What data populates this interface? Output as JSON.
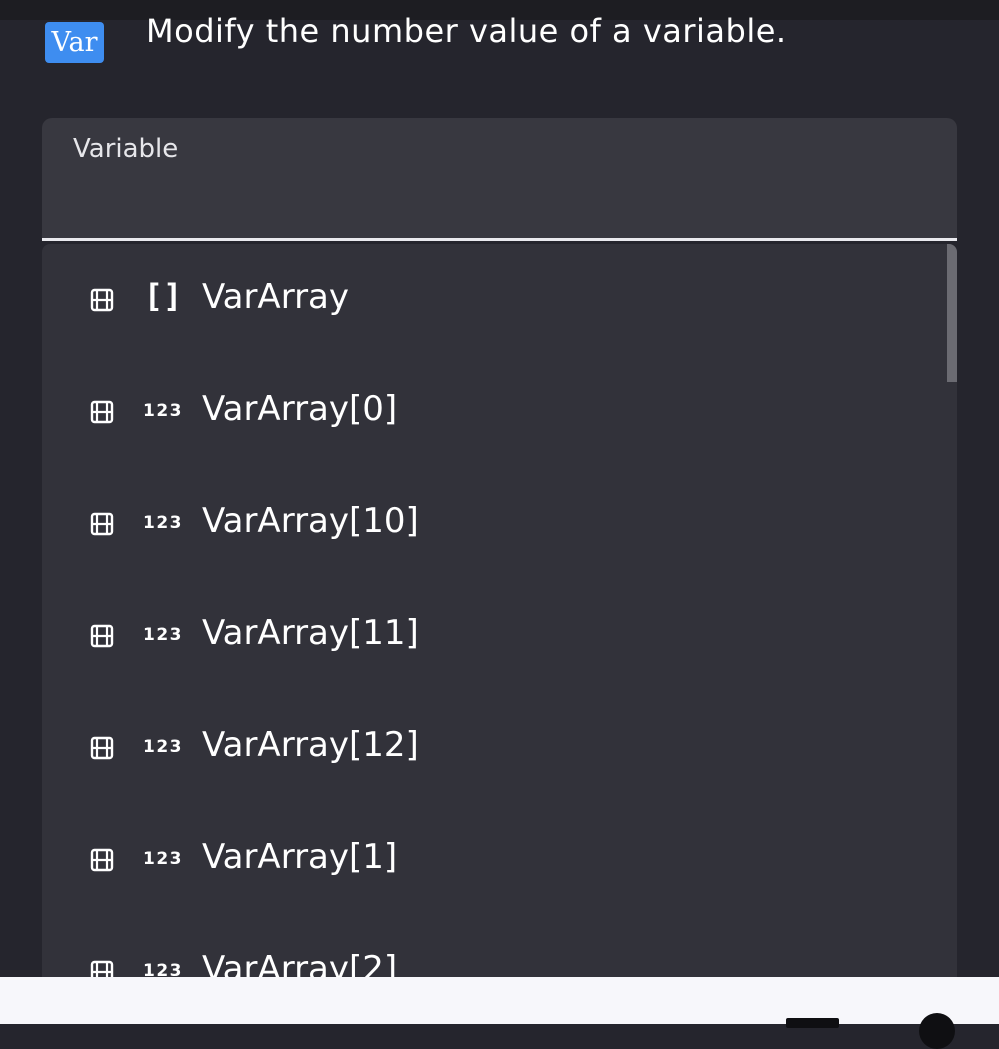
{
  "header": {
    "badge_text": "Var",
    "badge_color": "#3e8df0",
    "description": "Modify the number value of a variable."
  },
  "field": {
    "label": "Variable"
  },
  "dropdown": {
    "items": [
      {
        "label": "VarArray",
        "type_icon": "array-brackets-icon",
        "type_text": "[]"
      },
      {
        "label": "VarArray[0]",
        "type_icon": "number-type-icon",
        "type_text": "123"
      },
      {
        "label": "VarArray[10]",
        "type_icon": "number-type-icon",
        "type_text": "123"
      },
      {
        "label": "VarArray[11]",
        "type_icon": "number-type-icon",
        "type_text": "123"
      },
      {
        "label": "VarArray[12]",
        "type_icon": "number-type-icon",
        "type_text": "123"
      },
      {
        "label": "VarArray[1]",
        "type_icon": "number-type-icon",
        "type_text": "123"
      },
      {
        "label": "VarArray[2]",
        "type_icon": "number-type-icon",
        "type_text": "123"
      }
    ]
  },
  "colors": {
    "background": "#25252d",
    "field_bg": "#383840",
    "dropdown_bg": "#32323a",
    "bottom_bar": "#f7f7fb"
  }
}
